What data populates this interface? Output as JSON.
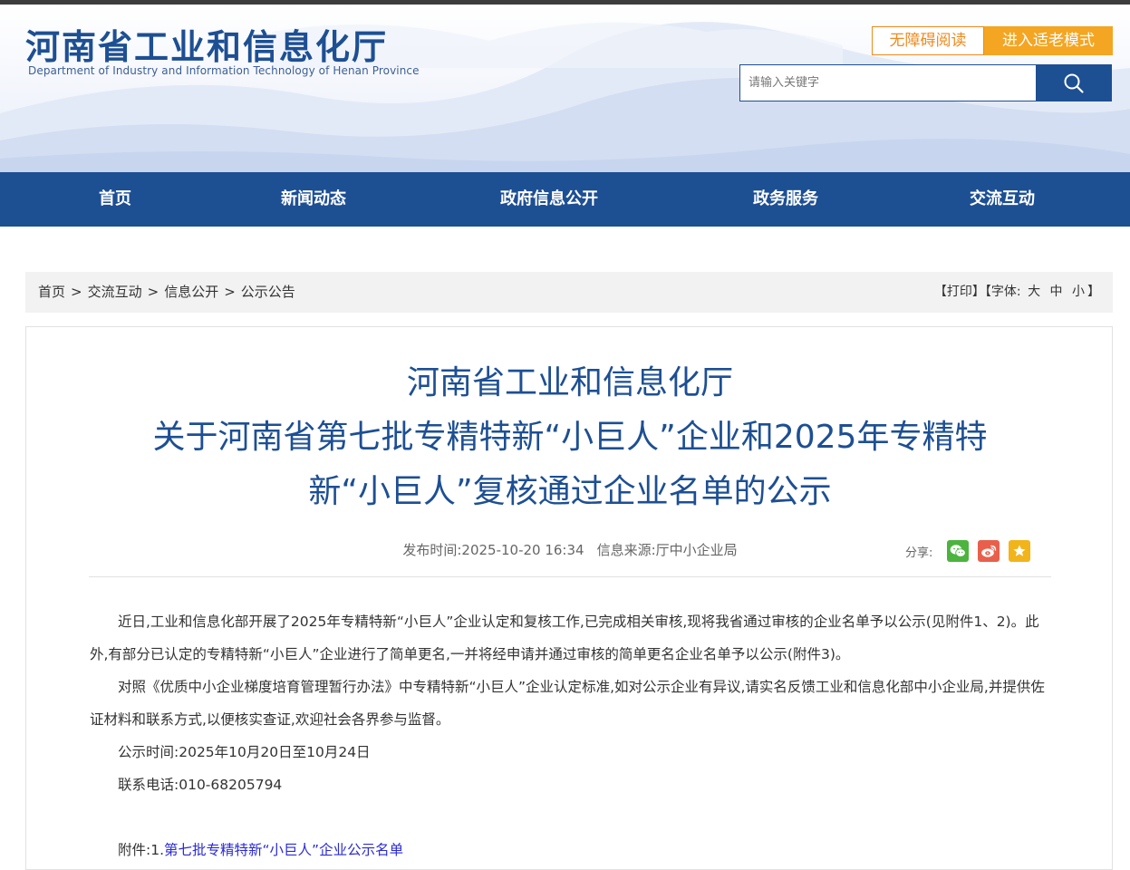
{
  "header": {
    "logo_cn": "河南省工业和信息化厅",
    "logo_en": "Department of Industry and Information Technology of Henan Province",
    "accessible_label": "无障碍阅读",
    "elder_mode_label": "进入适老模式",
    "search_placeholder": "请输入关键字"
  },
  "nav": {
    "items": [
      "首页",
      "新闻动态",
      "政府信息公开",
      "政务服务",
      "交流互动"
    ]
  },
  "breadcrumb": {
    "items": [
      "首页",
      "交流互动",
      "信息公开",
      "公示公告"
    ],
    "separator": ">"
  },
  "tools": {
    "print": "【打印】",
    "font_prefix": "【字体:",
    "font_large": "大",
    "font_medium": "中",
    "font_small": "小",
    "font_suffix": "】"
  },
  "article": {
    "title_lines": [
      "河南省工业和信息化厅",
      "关于河南省第七批专精特新“小巨人”企业和2025年专精特",
      "新“小巨人”复核通过企业名单的公示"
    ],
    "publish_label": "发布时间:",
    "publish_time": "2025-10-20 16:34",
    "source_label": "信息来源:",
    "source": "厅中小企业局",
    "share_label": "分享:",
    "paragraphs": [
      "近日,工业和信息化部开展了2025年专精特新“小巨人”企业认定和复核工作,已完成相关审核,现将我省通过审核的企业名单予以公示(见附件1、2)。此外,有部分已认定的专精特新“小巨人”企业进行了简单更名,一并将经申请并通过审核的简单更名企业名单予以公示(附件3)。",
      "对照《优质中小企业梯度培育管理暂行办法》中专精特新“小巨人”企业认定标准,如对公示企业有异议,请实名反馈工业和信息化部中小企业局,并提供佐证材料和联系方式,以便核实查证,欢迎社会各界参与监督。",
      "公示时间:2025年10月20日至10月24日",
      "联系电话:010-68205794"
    ],
    "attachment_prefix": "附件:1.",
    "attachment_1": "第七批专精特新“小巨人”企业公示名单"
  },
  "colors": {
    "brand_blue": "#1d4f93",
    "accent_orange": "#f4a522",
    "wechat_green": "#4cb33f",
    "weibo_red": "#e8604c",
    "favorite_yellow": "#f2b41b",
    "link_blue": "#2b2bd6"
  },
  "icons": {
    "search": "search-icon",
    "wechat": "wechat-icon",
    "weibo": "weibo-icon",
    "favorite": "star-icon"
  }
}
